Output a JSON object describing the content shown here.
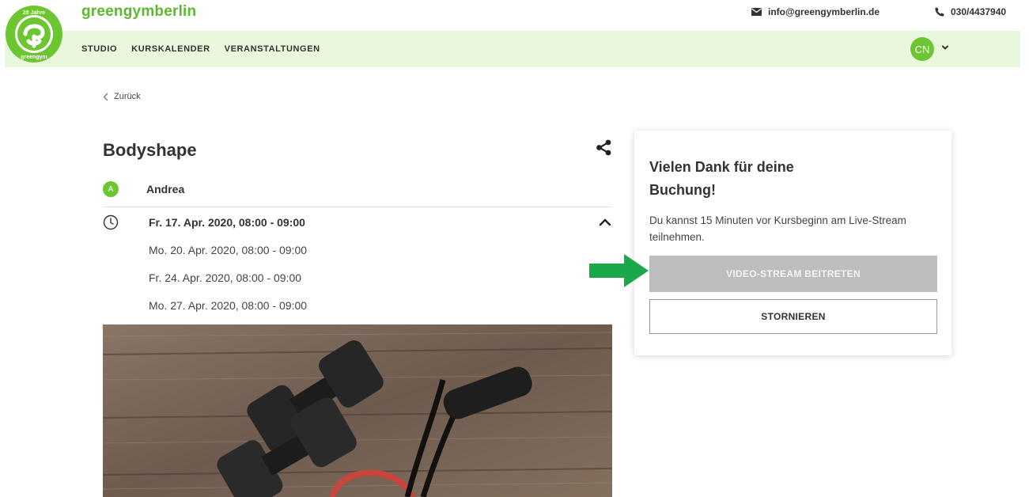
{
  "brand": {
    "name": "greengymberlin",
    "logo_ring_text": "28 Jahre greengymberlin",
    "color": "#5cb92e"
  },
  "contact": {
    "email": "info@greengymberlin.de",
    "phone": "030/4437940"
  },
  "nav": {
    "items": [
      {
        "label": "STUDIO"
      },
      {
        "label": "KURSKALENDER"
      },
      {
        "label": "VERANSTALTUNGEN"
      }
    ],
    "user_initials": "CN",
    "background": "#e9f8dc"
  },
  "back": {
    "label": "Zurück"
  },
  "course": {
    "title": "Bodyshape",
    "trainer_initial": "A",
    "trainer_name": "Andrea",
    "selected_date": "Fr. 17. Apr. 2020, 08:00 - 09:00",
    "other_dates": [
      "Mo. 20. Apr. 2020, 08:00 - 09:00",
      "Fr. 24. Apr. 2020, 08:00 - 09:00",
      "Mo. 27. Apr. 2020, 08:00 - 09:00"
    ]
  },
  "booking": {
    "title": "Vielen Dank für deine Buchung!",
    "text": "Du kannst 15 Minuten vor Kursbeginn am Live-Stream teilnehmen.",
    "video_button": "VIDEO-STREAM BEITRETEN",
    "cancel_button": "STORNIEREN"
  },
  "colors": {
    "accent_green": "#6cc632",
    "arrow_green": "#1aa84a",
    "disabled_button": "#bdbdbd"
  }
}
